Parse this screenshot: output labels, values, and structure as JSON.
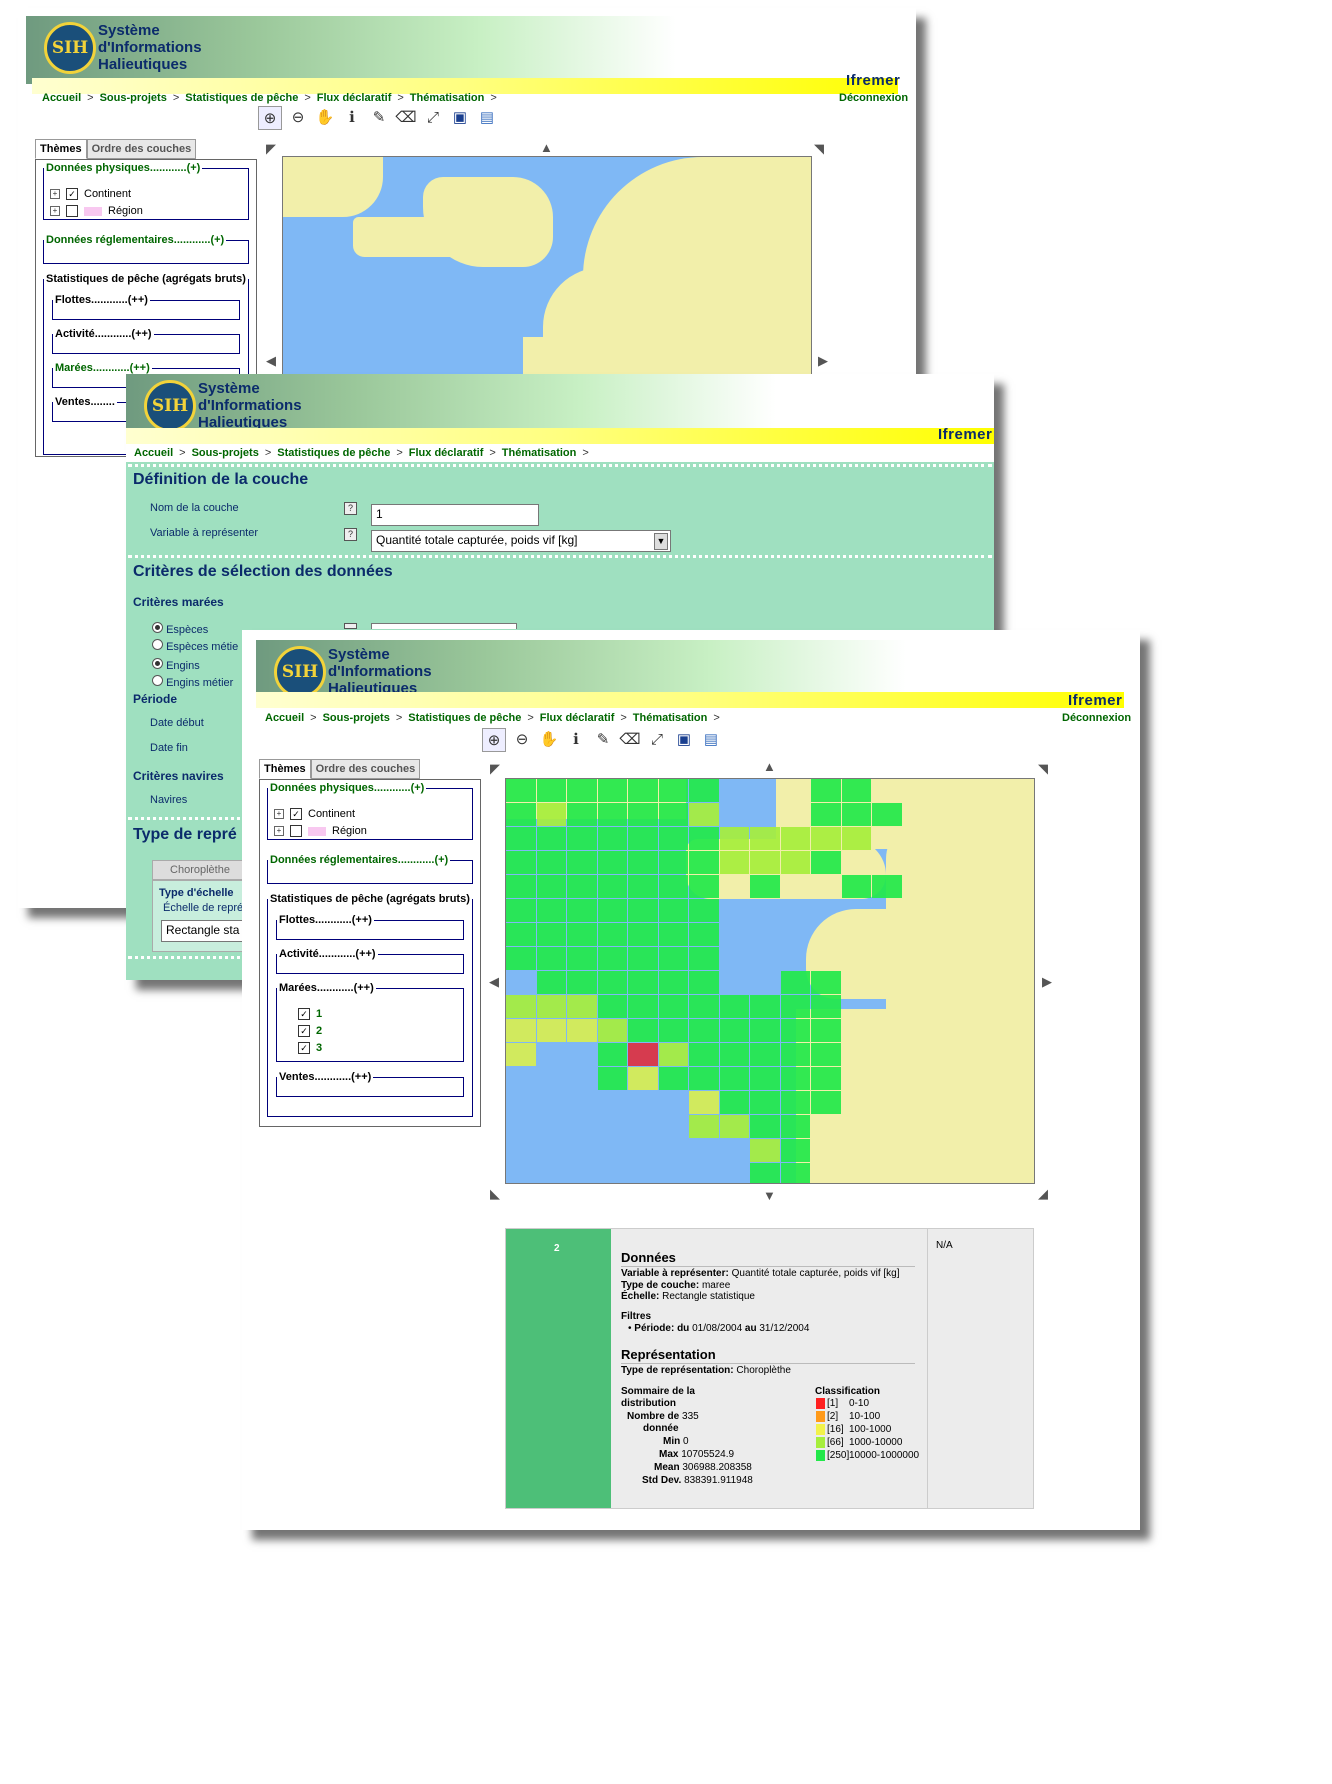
{
  "app": {
    "logo_abbr": "SIH",
    "logo_line1": "Système",
    "logo_line2": "d'Informations",
    "logo_line3": "Halieutiques",
    "brand": "Ifremer",
    "logout": "Déconnexion"
  },
  "breadcrumbs": [
    "Accueil",
    "Sous-projets",
    "Statistiques de pêche",
    "Flux déclaratif",
    "Thématisation"
  ],
  "toolbar": [
    "zoom-in-icon",
    "zoom-out-icon",
    "pan-hand-icon",
    "info-icon",
    "measure-icon",
    "clear-icon",
    "full-extent-icon",
    "save-icon",
    "folder-icon"
  ],
  "tabs": {
    "themes": "Thèmes",
    "order": "Ordre des couches"
  },
  "layers": {
    "physical": "Données physiques............(+)",
    "continent": "Continent",
    "region": "Région",
    "regulatory": "Données réglementaires............(+)",
    "fishing_stats": "Statistiques de pêche (agrégats bruts)",
    "fleets": "Flottes............(++)",
    "activity": "Activité............(++)",
    "tides": "Marées............(++)",
    "tide_items": [
      "1",
      "2",
      "3"
    ],
    "sales": "Ventes............(++)",
    "sales_cut": "Ventes........"
  },
  "form": {
    "layer_def_title": "Définition de la couche",
    "layer_name_label": "Nom de la couche",
    "layer_name_value": "1",
    "variable_label": "Variable à représenter",
    "variable_value": "Quantité totale capturée, poids vif [kg]",
    "criteria_title": "Critères de sélection des données",
    "tide_criteria": "Critères marées",
    "opt_species": "Espèces",
    "opt_species_job": "Espèces métie",
    "opt_gear": "Engins",
    "opt_gear_job": "Engins métier",
    "period": "Période",
    "start_date": "Date début",
    "end_date": "Date fin",
    "vessel_criteria": "Critères navires",
    "vessels": "Navires",
    "repr_title": "Type de repré",
    "choropleth_btn": "Choroplèthe",
    "scale_type": "Type d'échelle",
    "scale_label": "Échelle de repré",
    "scale_value": "Rectangle sta"
  },
  "legend": {
    "layer_id": "2",
    "na": "N/A",
    "data_title": "Données",
    "variable_key": "Variable à représenter:",
    "variable_val": "Quantité totale capturée, poids vif [kg]",
    "layer_type_key": "Type de couche:",
    "layer_type_val": "maree",
    "scale_key": "Échelle:",
    "scale_val": "Rectangle statistique",
    "filters": "Filtres",
    "period_key": "Période:",
    "period_from": "du",
    "period_start": "01/08/2004",
    "period_to": "au",
    "period_end": "31/12/2004",
    "repr_title": "Représentation",
    "repr_type_key": "Type de représentation:",
    "repr_type_val": "Choroplèthe",
    "summary_title_1": "Sommaire de la",
    "summary_title_2": "distribution",
    "count_key_1": "Nombre de",
    "count_key_2": "donnée",
    "count_val": "335",
    "min_key": "Min",
    "min_val": "0",
    "max_key": "Max",
    "max_val": "10705524.9",
    "mean_key": "Mean",
    "mean_val": "306988.208358",
    "std_key": "Std Dev.",
    "std_val": "838391.911948",
    "classification": "Classification",
    "classes": [
      {
        "count": "[1]",
        "range": "0-10",
        "color": "#ff2020"
      },
      {
        "count": "[2]",
        "range": "10-100",
        "color": "#ff9a1a"
      },
      {
        "count": "[16]",
        "range": "100-1000",
        "color": "#f2f24a"
      },
      {
        "count": "[66]",
        "range": "1000-10000",
        "color": "#a6ee3c"
      },
      {
        "count": "[250]",
        "range": "10000-1000000",
        "color": "#22e84a"
      }
    ]
  }
}
